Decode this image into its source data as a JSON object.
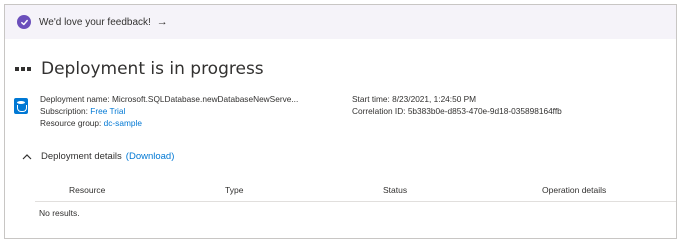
{
  "feedback": {
    "text": "We'd love your feedback!",
    "arrow": "→",
    "icon": "heart-check-icon",
    "icon_color": "#6b4fbb"
  },
  "header": {
    "title": "Deployment is in progress",
    "more_icon": "more-icon"
  },
  "deployment": {
    "icon": "sql-database-icon",
    "name_label": "Deployment name:",
    "name_value": "Microsoft.SQLDatabase.newDatabaseNewServe...",
    "subscription_label": "Subscription:",
    "subscription_value": "Free Trial",
    "resource_group_label": "Resource group:",
    "resource_group_value": "dc-sample",
    "start_time_label": "Start time:",
    "start_time_value": "8/23/2021, 1:24:50 PM",
    "correlation_label": "Correlation ID:",
    "correlation_value": "5b383b0e-d853-470e-9d18-035898164ffb"
  },
  "details": {
    "label": "Deployment details",
    "download_label": "(Download)",
    "columns": [
      "Resource",
      "Type",
      "Status",
      "Operation details"
    ],
    "empty_text": "No results."
  },
  "colors": {
    "accent": "#0078d4",
    "text": "#323130",
    "feedback_bg": "#f5f3f9"
  }
}
